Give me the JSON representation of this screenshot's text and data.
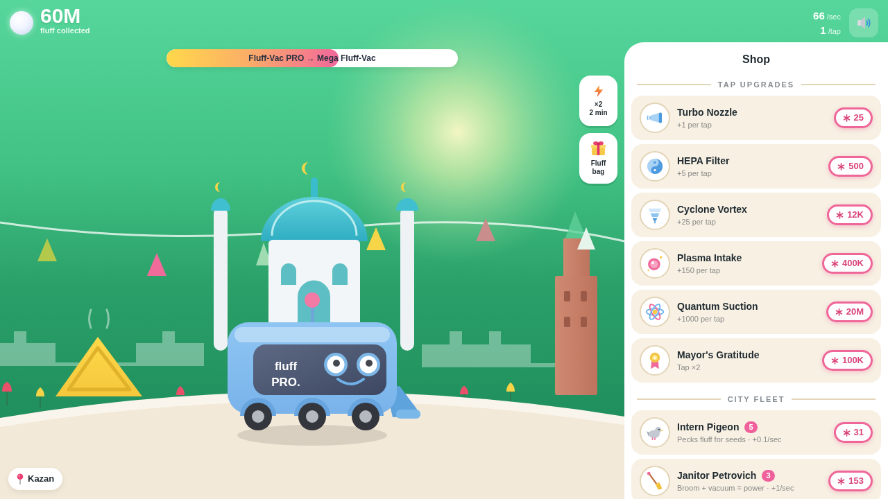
{
  "hud": {
    "total": "60M",
    "total_caption": "fluff collected",
    "rates": [
      {
        "value": "66",
        "unit": "/sec"
      },
      {
        "value": "1",
        "unit": "/tap"
      }
    ],
    "sound_on": true
  },
  "progress": {
    "label": "Fluff-Vac PRO → Mega Fluff-Vac",
    "level": 0.59
  },
  "boosts": [
    {
      "kind": "multiplier",
      "lines": [
        "×2",
        "2 min"
      ]
    },
    {
      "kind": "gift",
      "lines": [
        "Fluff",
        "bag"
      ]
    }
  ],
  "scene": {
    "vehicle_logo": [
      "fluff",
      "PRO."
    ]
  },
  "shop": {
    "title": "Shop",
    "sections": [
      {
        "heading": "TAP UPGRADES",
        "items": [
          {
            "name": "Turbo Nozzle",
            "description": "+1 per tap",
            "price": "25"
          },
          {
            "name": "HEPA Filter",
            "description": "+5 per tap",
            "price": "500"
          },
          {
            "name": "Cyclone Vortex",
            "description": "+25 per tap",
            "price": "12K"
          },
          {
            "name": "Plasma Intake",
            "description": "+150 per tap",
            "price": "400K"
          },
          {
            "name": "Quantum Suction",
            "description": "+1000 per tap",
            "price": "20M"
          },
          {
            "name": "Mayor's Gratitude",
            "description": "Tap ×2",
            "price": "100K"
          }
        ]
      },
      {
        "heading": "CITY FLEET",
        "items": [
          {
            "name": "Intern Pigeon",
            "count": "5",
            "description": "Pecks fluff for seeds · +0.1/sec",
            "price": "31"
          },
          {
            "name": "Janitor Petrovich",
            "count": "3",
            "description": "Broom + vacuum = power · +1/sec",
            "price": "153"
          }
        ]
      }
    ]
  },
  "location": {
    "name": "Kazan"
  }
}
